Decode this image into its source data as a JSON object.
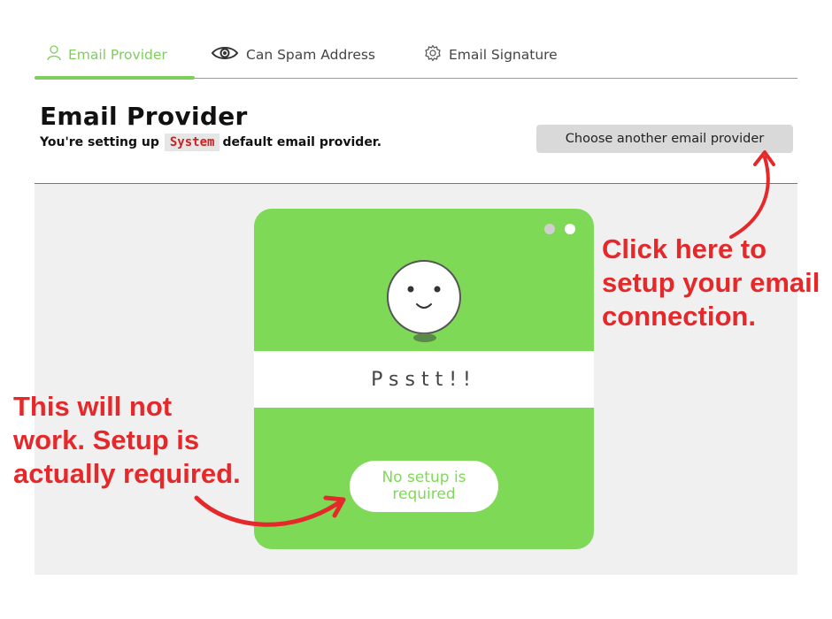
{
  "tabs": [
    {
      "label": "Email Provider",
      "icon": "user-icon",
      "active": true
    },
    {
      "label": "Can Spam Address",
      "icon": "eye-icon",
      "active": false
    },
    {
      "label": "Email Signature",
      "icon": "gear-icon",
      "active": false
    }
  ],
  "header": {
    "title": "Email Provider",
    "subtitle_prefix": "You're setting up",
    "provider_name": "System",
    "subtitle_suffix": "default email provider.",
    "choose_button": "Choose another email provider"
  },
  "card": {
    "message": "Psstt!!",
    "badge": "No setup is required"
  },
  "annotations": {
    "right": "Click here to\nsetup your email\nconnection.",
    "left": "This will not\nwork. Setup is\nactually required."
  },
  "colors": {
    "accent": "#7ed957",
    "annotation": "#e5282a",
    "panel": "#f0f0f0"
  }
}
